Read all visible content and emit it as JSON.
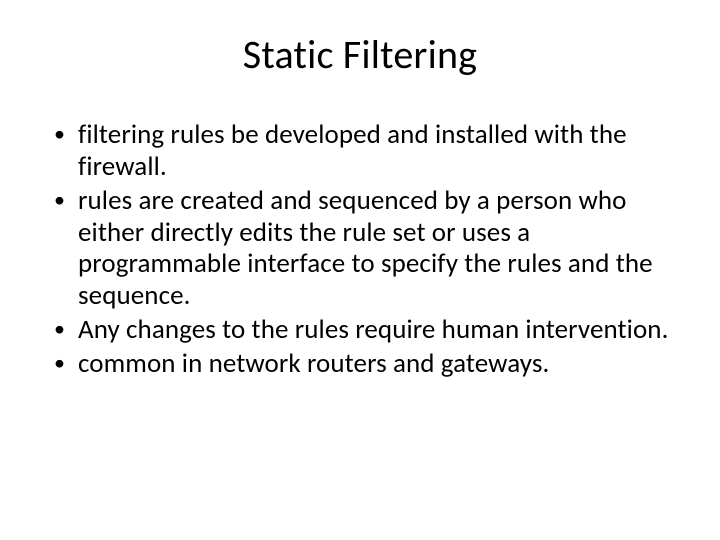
{
  "title": "Static Filtering",
  "bullets": [
    "filtering rules be developed and installed with the firewall.",
    "rules are created and sequenced by a person who either directly edits the rule set or uses a programmable interface to specify the rules and the sequence.",
    "Any changes to the rules require human intervention.",
    "common in network routers and gateways."
  ]
}
